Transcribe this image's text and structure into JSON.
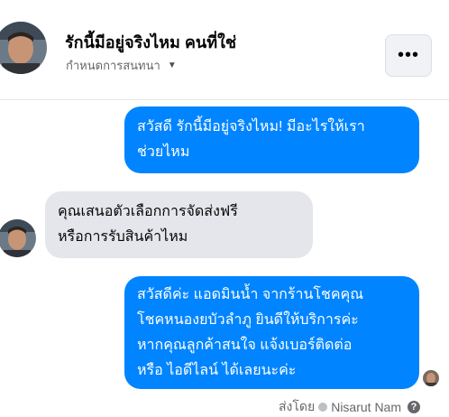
{
  "header": {
    "title": "รักนี้มีอยู่จริงไหม คนที่ใช่",
    "subtitle": "กำหนดการสนทนา",
    "more_label": "•••"
  },
  "messages": [
    {
      "direction": "outgoing",
      "lines": [
        "สวัสดี รักนี้มีอยู่จริงไหม! มีอะไรให้เรา",
        "ช่วยไหม"
      ]
    },
    {
      "direction": "incoming",
      "lines": [
        "คุณเสนอตัวเลือกการจัดส่งฟรี",
        "หรือการรับสินค้าไหม"
      ]
    },
    {
      "direction": "outgoing",
      "lines": [
        "สวัสดีค่ะ แอดมินน้ำ จากร้านโชคคุณ",
        "โชคหนองยบัวลำภู ยินดีให้บริการค่ะ",
        "หากคุณลูกค้าสนใจ แจ้งเบอร์ติดต่อ",
        "หรือ ไอดีไลน์ ได้เลยนะค่ะ"
      ]
    }
  ],
  "footer": {
    "sent_by_label": "ส่งโดย",
    "sender_name": "Nisarut Nam",
    "help_label": "?"
  },
  "colors": {
    "outgoing_bubble": "#0084ff",
    "incoming_bubble": "#e4e6eb",
    "secondary_text": "#65676b"
  },
  "icons": {
    "profile_avatar": "avatar",
    "dropdown": "caret-down-icon",
    "more": "more-horizontal-icon",
    "verified": "check-circle-icon",
    "help": "question-circle-icon"
  }
}
